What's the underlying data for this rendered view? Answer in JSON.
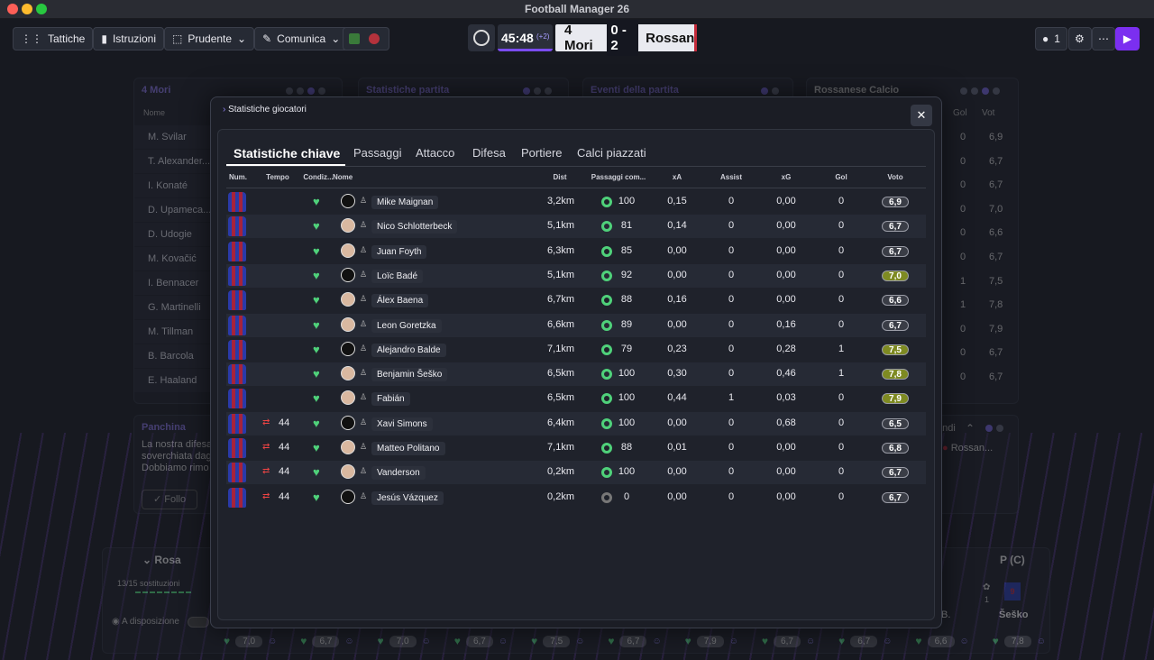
{
  "window": {
    "title": "Football Manager 26"
  },
  "toolbar": {
    "tactics": "Tattiche",
    "instructions": "Istruzioni",
    "mentality": "Prudente",
    "communicate": "Comunica"
  },
  "match": {
    "time": "45:48",
    "added": "(+2)",
    "home": "4 Mori",
    "score": "0 - 2",
    "away": "Rossan",
    "right_count": "1"
  },
  "bg": {
    "home_panel": "4 Mori",
    "stats_panel": "Statistiche partita",
    "events_panel": "Eventi della partita",
    "away_panel": "Rossanese Calcio",
    "name_col": "Nome",
    "gol_col": "Gol",
    "vot_col": "Vot",
    "players": [
      "M. Svilar",
      "T. Alexander...",
      "I. Konaté",
      "D. Upameca...",
      "D. Udogie",
      "M. Kovačić",
      "I. Bennacer",
      "G. Martinelli",
      "M. Tillman",
      "B. Barcola",
      "E. Haaland"
    ],
    "away_rows": [
      [
        "0",
        "6,9"
      ],
      [
        "0",
        "6,7"
      ],
      [
        "0",
        "6,7"
      ],
      [
        "0",
        "7,0"
      ],
      [
        "0",
        "6,6"
      ],
      [
        "0",
        "6,7"
      ],
      [
        "1",
        "7,5"
      ],
      [
        "1",
        "7,8"
      ],
      [
        "0",
        "7,9"
      ],
      [
        "0",
        "6,7"
      ],
      [
        "0",
        "6,7"
      ]
    ],
    "bench_title": "Panchina",
    "bench_text": [
      "La nostra difesa",
      "soverchiata dag",
      "Dobbiamo rimo"
    ],
    "follow": "Follo",
    "expand": "andi",
    "away_short": "Rossan...",
    "squad": "Rosa",
    "subs": "13/15 sostituzioni",
    "available": "A disposizione",
    "pos": "P (C)",
    "player_num": "9",
    "player_name": "Šeško",
    "b_label": "B.",
    "mini": "1",
    "bottom_ratings": [
      "7,0",
      "6,7",
      "7,0",
      "6,7",
      "7,5",
      "6,7",
      "7,9",
      "6,7",
      "6,7",
      "6,6",
      "7,8"
    ]
  },
  "modal": {
    "breadcrumb": "Statistiche giocatori",
    "tabs": [
      "Statistiche chiave",
      "Passaggi",
      "Attacco",
      "Difesa",
      "Portiere",
      "Calci piazzati"
    ],
    "headers": [
      "Num.",
      "Tempo",
      "Condiz...",
      "Nome",
      "Dist",
      "Passaggi com...",
      "xA",
      "Assist",
      "xG",
      "Gol",
      "Voto"
    ],
    "rows": [
      {
        "tempo": "",
        "name": "Mike Maignan",
        "dist": "3,2km",
        "pass": "100",
        "xa": "0,15",
        "assist": "0",
        "xg": "0,00",
        "gol": "0",
        "voto": "6,9",
        "good": false
      },
      {
        "tempo": "",
        "name": "Nico Schlotterbeck",
        "dist": "5,1km",
        "pass": "81",
        "xa": "0,14",
        "assist": "0",
        "xg": "0,00",
        "gol": "0",
        "voto": "6,7",
        "good": false
      },
      {
        "tempo": "",
        "name": "Juan Foyth",
        "dist": "6,3km",
        "pass": "85",
        "xa": "0,00",
        "assist": "0",
        "xg": "0,00",
        "gol": "0",
        "voto": "6,7",
        "good": false
      },
      {
        "tempo": "",
        "name": "Loïc Badé",
        "dist": "5,1km",
        "pass": "92",
        "xa": "0,00",
        "assist": "0",
        "xg": "0,00",
        "gol": "0",
        "voto": "7,0",
        "good": true
      },
      {
        "tempo": "",
        "name": "Álex Baena",
        "dist": "6,7km",
        "pass": "88",
        "xa": "0,16",
        "assist": "0",
        "xg": "0,00",
        "gol": "0",
        "voto": "6,6",
        "good": false
      },
      {
        "tempo": "",
        "name": "Leon Goretzka",
        "dist": "6,6km",
        "pass": "89",
        "xa": "0,00",
        "assist": "0",
        "xg": "0,16",
        "gol": "0",
        "voto": "6,7",
        "good": false
      },
      {
        "tempo": "",
        "name": "Alejandro Balde",
        "dist": "7,1km",
        "pass": "79",
        "xa": "0,23",
        "assist": "0",
        "xg": "0,28",
        "gol": "1",
        "voto": "7,5",
        "good": true
      },
      {
        "tempo": "",
        "name": "Benjamin Šeško",
        "dist": "6,5km",
        "pass": "100",
        "xa": "0,30",
        "assist": "0",
        "xg": "0,46",
        "gol": "1",
        "voto": "7,8",
        "good": true
      },
      {
        "tempo": "",
        "name": "Fabián",
        "dist": "6,5km",
        "pass": "100",
        "xa": "0,44",
        "assist": "1",
        "xg": "0,03",
        "gol": "0",
        "voto": "7,9",
        "good": true
      },
      {
        "tempo": "44",
        "name": "Xavi Simons",
        "dist": "6,4km",
        "pass": "100",
        "xa": "0,00",
        "assist": "0",
        "xg": "0,68",
        "gol": "0",
        "voto": "6,5",
        "good": false
      },
      {
        "tempo": "44",
        "name": "Matteo Politano",
        "dist": "7,1km",
        "pass": "88",
        "xa": "0,01",
        "assist": "0",
        "xg": "0,00",
        "gol": "0",
        "voto": "6,8",
        "good": false
      },
      {
        "tempo": "44",
        "name": "Vanderson",
        "dist": "0,2km",
        "pass": "100",
        "xa": "0,00",
        "assist": "0",
        "xg": "0,00",
        "gol": "0",
        "voto": "6,7",
        "good": false
      },
      {
        "tempo": "44",
        "name": "Jesús Vázquez",
        "dist": "0,2km",
        "pass": "0",
        "xa": "0,00",
        "assist": "0",
        "xg": "0,00",
        "gol": "0",
        "voto": "6,7",
        "good": false
      }
    ]
  },
  "colors": {
    "accent": "#7b4cf0",
    "good_rating": "#7e8a22",
    "condition": "#4fd17a"
  }
}
